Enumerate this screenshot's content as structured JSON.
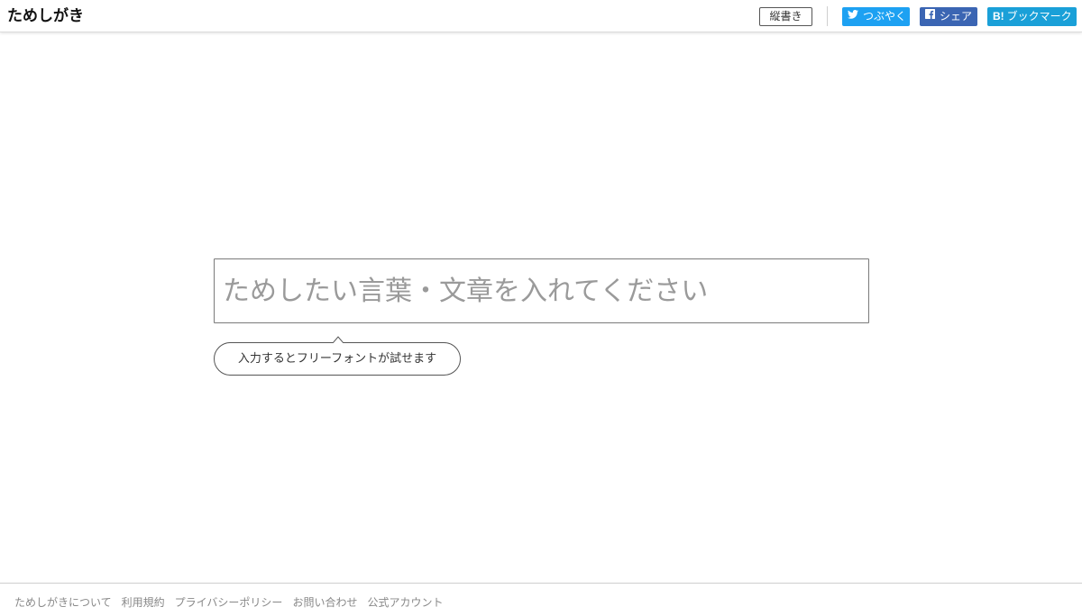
{
  "header": {
    "logo": "ためしがき",
    "vertical_button": "縦書き",
    "share": {
      "twitter_label": "つぶやく",
      "facebook_label": "シェア",
      "hatena_icon": "B!",
      "hatena_label": "ブックマーク"
    },
    "icons": {
      "twitter": "twitter-bird-icon",
      "facebook": "facebook-f-icon",
      "hatena": "hatena-bookmark-icon"
    }
  },
  "main": {
    "input_placeholder": "ためしたい言葉・文章を入れてください",
    "input_value": "",
    "hint": "入力するとフリーフォントが試せます"
  },
  "footer": {
    "links": [
      "ためしがきについて",
      "利用規約",
      "プライバシーポリシー",
      "お問い合わせ",
      "公式アカウント"
    ]
  },
  "colors": {
    "twitter": "#1da1f2",
    "facebook": "#3b65b3",
    "hatena": "#1aa0d8",
    "footer_link": "#888888"
  }
}
